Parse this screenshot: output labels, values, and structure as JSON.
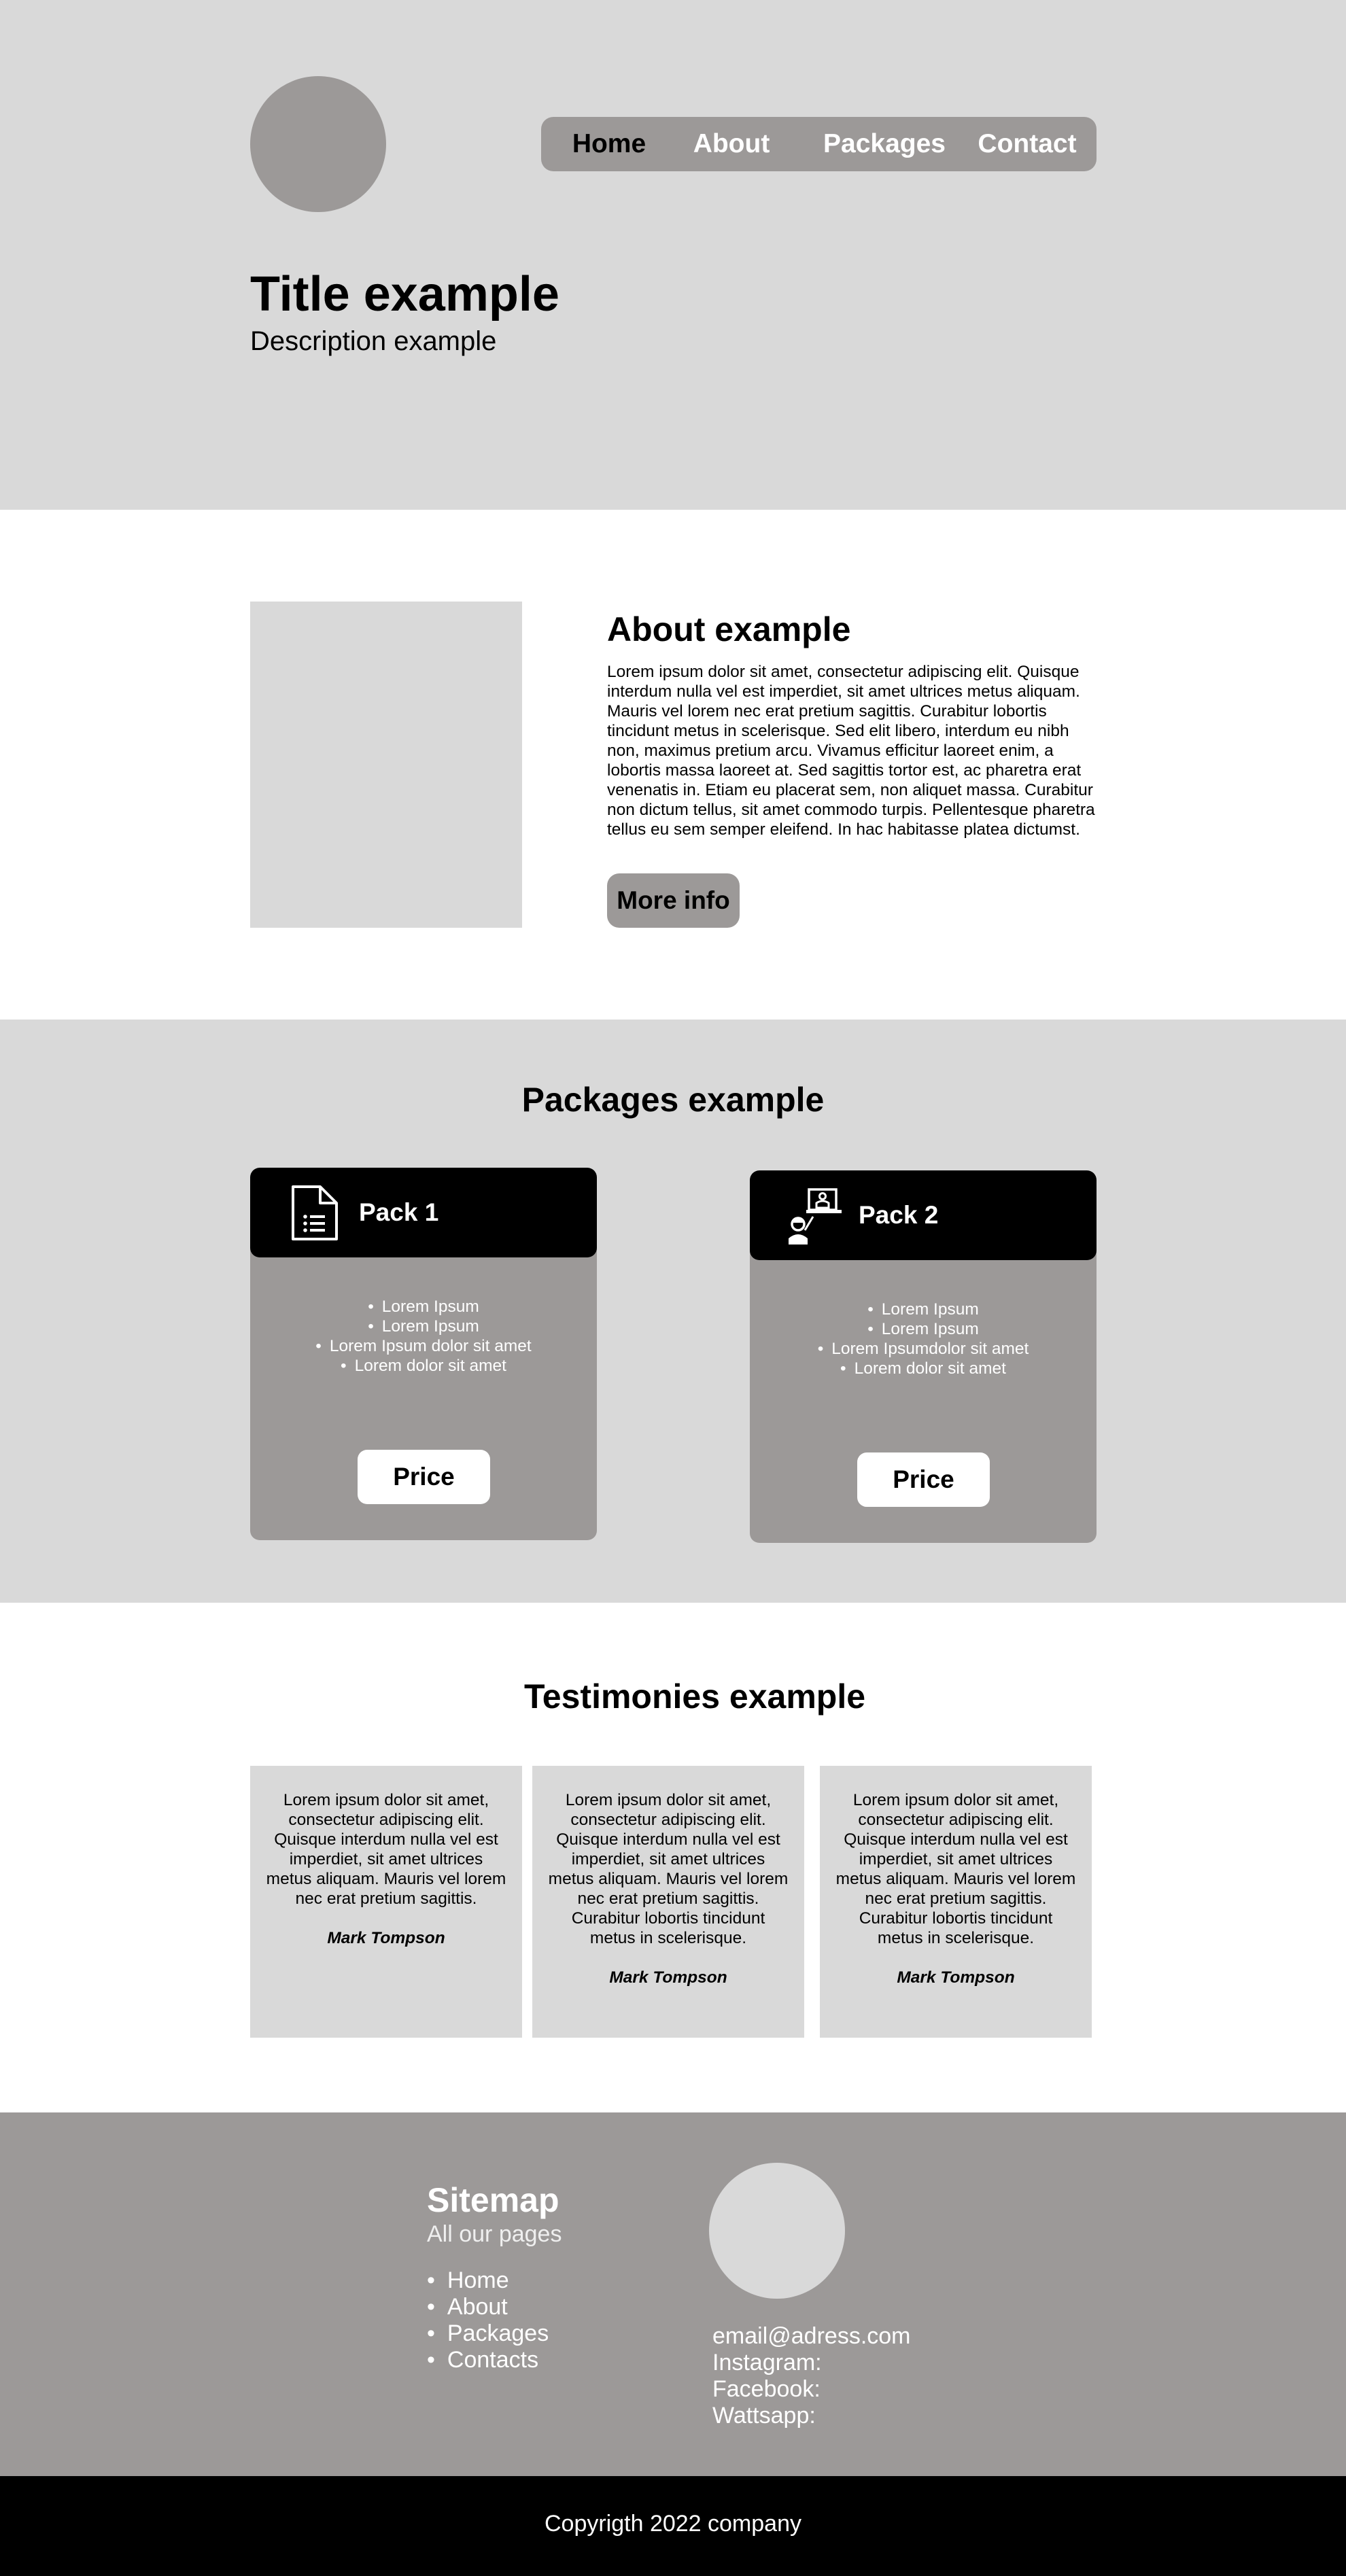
{
  "nav": {
    "items": [
      {
        "label": "Home",
        "active": true
      },
      {
        "label": "About",
        "active": false
      },
      {
        "label": "Packages",
        "active": false
      },
      {
        "label": "Contact",
        "active": false
      }
    ]
  },
  "hero": {
    "title": "Title example",
    "description": "Description example"
  },
  "about": {
    "title": "About example",
    "text": "Lorem ipsum dolor sit amet, consectetur adipiscing elit. Quisque interdum nulla vel est imperdiet, sit amet ultrices metus aliquam. Mauris vel lorem nec erat pretium sagittis. Curabitur lobortis tincidunt metus in scelerisque. Sed elit libero, interdum eu nibh non, maximus pretium arcu. Vivamus efficitur laoreet enim, a lobortis massa laoreet at. Sed sagittis tortor est, ac pharetra erat venenatis in. Etiam eu placerat sem, non aliquet massa. Curabitur non dictum tellus, sit amet commodo turpis. Pellentesque pharetra tellus eu sem semper eleifend. In hac habitasse platea dictumst.",
    "button_label": "More info"
  },
  "packages": {
    "title": "Packages example",
    "items": [
      {
        "name": "Pack 1",
        "icon": "document-list-icon",
        "features": [
          "Lorem Ipsum",
          "Lorem Ipsum",
          "Lorem Ipsum dolor sit amet",
          "Lorem dolor sit amet"
        ],
        "button_label": "Price"
      },
      {
        "name": "Pack 2",
        "icon": "online-teacher-icon",
        "features": [
          "Lorem Ipsum",
          "Lorem Ipsum",
          "Lorem Ipsumdolor sit amet",
          "Lorem dolor sit amet"
        ],
        "button_label": "Price"
      }
    ]
  },
  "testimonies": {
    "title": "Testimonies example",
    "items": [
      {
        "text": "Lorem ipsum dolor sit amet, consectetur adipiscing elit. Quisque interdum nulla vel est imperdiet, sit amet ultrices metus aliquam. Mauris vel lorem nec erat pretium sagittis.",
        "author": "Mark Tompson"
      },
      {
        "text": "Lorem ipsum dolor sit amet, consectetur adipiscing elit. Quisque interdum nulla vel est imperdiet, sit amet ultrices metus aliquam. Mauris vel lorem nec erat pretium sagittis. Curabitur lobortis tincidunt metus in scelerisque.",
        "author": "Mark Tompson"
      },
      {
        "text": "Lorem ipsum dolor sit amet, consectetur adipiscing elit. Quisque interdum nulla vel est imperdiet, sit amet ultrices metus aliquam. Mauris vel lorem nec erat pretium sagittis. Curabitur lobortis tincidunt metus in scelerisque.",
        "author": "Mark Tompson"
      }
    ]
  },
  "footer": {
    "sitemap_title": "Sitemap",
    "sitemap_subtitle": "All our pages",
    "sitemap_links": [
      "Home",
      "About",
      "Packages",
      "Contacts"
    ],
    "contacts": [
      "email@adress.com",
      "Instagram:",
      "Facebook:",
      "Wattsapp:"
    ],
    "copyright": "Copyrigth 2022 company"
  },
  "colors": {
    "light_gray": "#d9d9d9",
    "mid_gray": "#9c9998",
    "black": "#000000",
    "white": "#ffffff"
  }
}
